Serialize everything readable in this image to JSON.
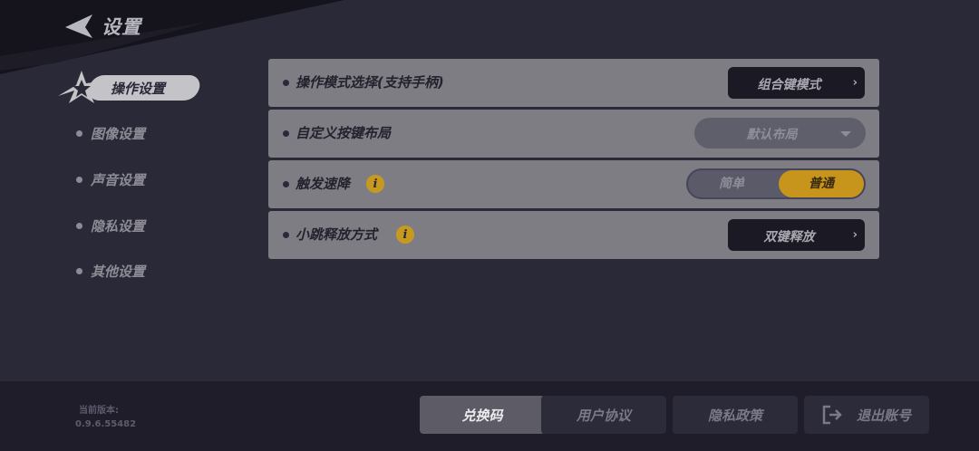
{
  "header": {
    "title": "设置"
  },
  "sidebar": {
    "active": {
      "label": "操作设置"
    },
    "items": [
      {
        "label": "图像设置"
      },
      {
        "label": "声音设置"
      },
      {
        "label": "隐私设置"
      },
      {
        "label": "其他设置"
      }
    ]
  },
  "settings": {
    "rows": [
      {
        "label": "操作模式选择(支持手柄)",
        "control": "button",
        "value": "组合键模式"
      },
      {
        "label": "自定义按键布局",
        "control": "dropdown",
        "value": "默认布局"
      },
      {
        "label": "触发速降",
        "control": "toggle",
        "options": [
          "简单",
          "普通"
        ],
        "selected": "普通",
        "info_icon": "info-icon"
      },
      {
        "label": "小跳释放方式",
        "control": "button",
        "value": "双键释放",
        "info_icon": "info-icon"
      }
    ]
  },
  "footer": {
    "version_label": "当前版本:",
    "version_value": "0.9.6.55482",
    "buttons": [
      {
        "label": "兑换码"
      },
      {
        "label": "用户协议"
      },
      {
        "label": "隐私政策"
      },
      {
        "label": "退出账号",
        "icon": "logout-icon"
      }
    ]
  },
  "colors": {
    "background": "#2a2938",
    "row": "#7e7d84",
    "accent": "#c7941c",
    "footer": "#1e1d29"
  }
}
